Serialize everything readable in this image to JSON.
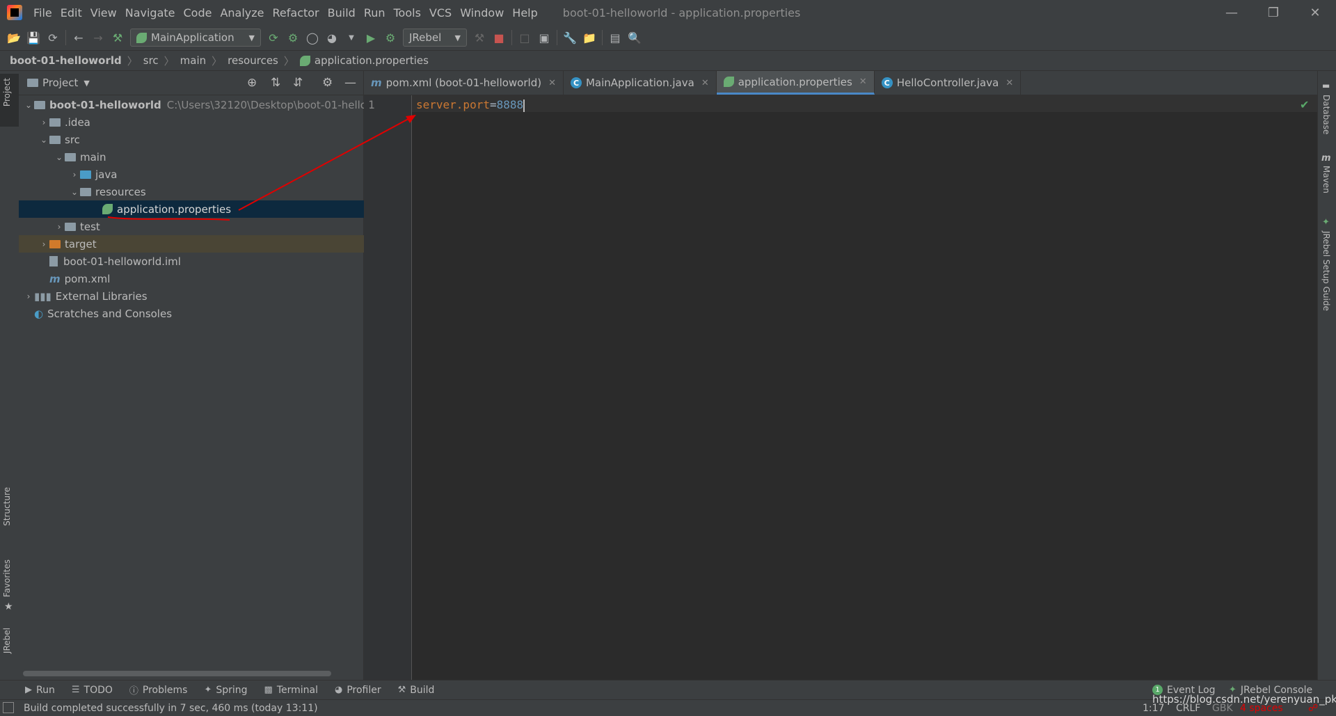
{
  "window": {
    "title": "boot-01-helloworld - application.properties"
  },
  "menu": [
    "File",
    "Edit",
    "View",
    "Navigate",
    "Code",
    "Analyze",
    "Refactor",
    "Build",
    "Run",
    "Tools",
    "VCS",
    "Window",
    "Help"
  ],
  "toolbar": {
    "run_config": "MainApplication",
    "jrebel_combo": "JRebel"
  },
  "breadcrumb": [
    "boot-01-helloworld",
    "src",
    "main",
    "resources",
    "application.properties"
  ],
  "project": {
    "header": "Project",
    "root_name": "boot-01-helloworld",
    "root_path": "C:\\Users\\32120\\Desktop\\boot-01-hello",
    "items": [
      ".idea",
      "src",
      "main",
      "java",
      "resources",
      "application.properties",
      "test",
      "target",
      "boot-01-helloworld.iml",
      "pom.xml",
      "External Libraries",
      "Scratches and Consoles"
    ]
  },
  "tabs": [
    {
      "label": "pom.xml (boot-01-helloworld)",
      "icon": "maven-icon"
    },
    {
      "label": "MainApplication.java",
      "icon": "class-icon"
    },
    {
      "label": "application.properties",
      "icon": "spring-icon",
      "active": true
    },
    {
      "label": "HelloController.java",
      "icon": "class-icon"
    }
  ],
  "editor": {
    "line_number": "1",
    "key": "server.port",
    "eq": "=",
    "value": "8888"
  },
  "left_stripe": {
    "project": "Project",
    "structure": "Structure",
    "favorites": "Favorites",
    "jrebel": "JRebel"
  },
  "right_stripe": {
    "database": "Database",
    "maven": "Maven",
    "jrebel_guide": "JRebel Setup Guide"
  },
  "bottom_tabs": [
    "Run",
    "TODO",
    "Problems",
    "Spring",
    "Terminal",
    "Profiler",
    "Build"
  ],
  "bottom_right": {
    "event_log_count": "1",
    "event_log": "Event Log",
    "jrebel_console": "JRebel Console"
  },
  "status": {
    "message": "Build completed successfully in 7 sec, 460 ms (today 13:11)",
    "position": "1:17",
    "line_sep": "CRLF",
    "encoding": "GBK",
    "indent": "4 spaces",
    "watermark": "https://blog.csdn.net/yerenyuan_pku"
  },
  "colors": {
    "accent": "#4a88c7",
    "key": "#cc7832",
    "value": "#6897bb",
    "annotation": "#e00000"
  }
}
